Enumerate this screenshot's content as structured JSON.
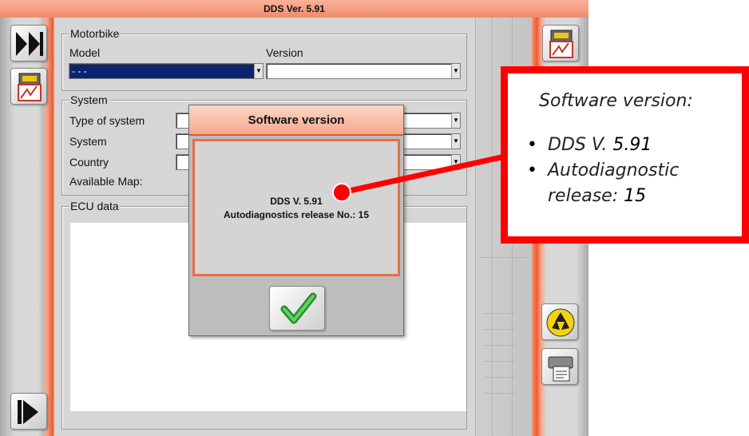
{
  "window": {
    "title": "DDS Ver.  5.91"
  },
  "motorbike": {
    "group_title": "Motorbike",
    "model_label": "Model",
    "version_label": "Version",
    "model_value": "- - -",
    "version_value": ""
  },
  "system": {
    "group_title": "System",
    "type_label": "Type of system",
    "system_label": "System",
    "country_label": "Country",
    "map_label": "Available Map:"
  },
  "ecu": {
    "group_title": "ECU data"
  },
  "dialog": {
    "title": "Software version",
    "line1": "DDS V. 5.91",
    "line2": "Autodiagnostics release No.: 15",
    "ok_icon": "checkmark-icon"
  },
  "callout": {
    "title": "Software version:",
    "items": [
      {
        "text": "DDS V. ",
        "value": "5.91"
      },
      {
        "text": "Autodiagnostic",
        "text2": "release: ",
        "value": "15"
      }
    ],
    "color": "#ff0000"
  },
  "sidebar": {
    "left_top_icon": "fast-forward-icon",
    "left_second_icon": "ecu-diagnostic-icon",
    "left_bottom_icon": "play-forward-icon",
    "right_top_icon": "ecu-diagnostic-icon",
    "right_recycle_icon": "recycle-icon",
    "right_printer_icon": "printer-icon"
  },
  "colors": {
    "accent": "#ee5a2e",
    "selection": "#0a2470",
    "callout_red": "#ff0000",
    "check_green": "#3cb043"
  }
}
